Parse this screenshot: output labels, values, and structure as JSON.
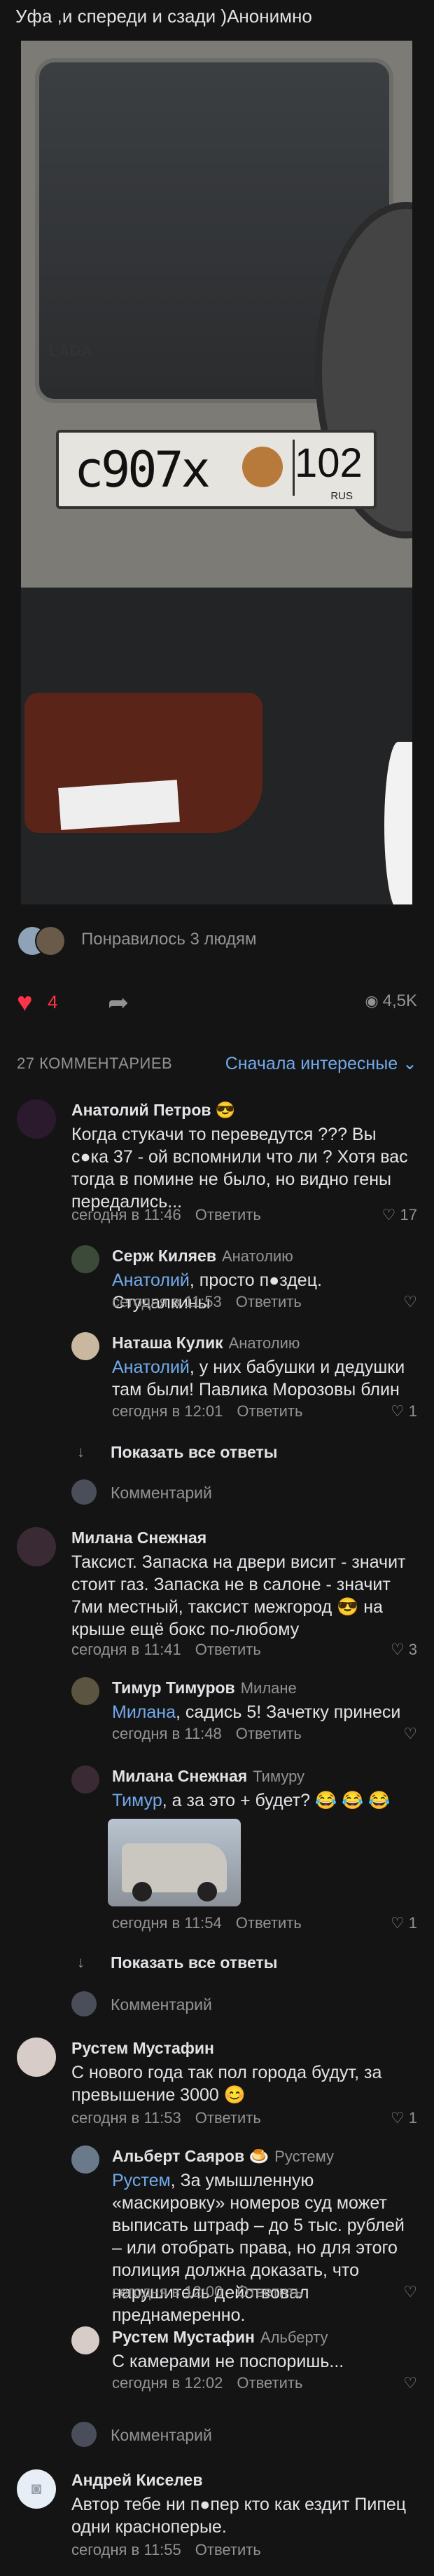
{
  "post": {
    "title": "Уфа ,и спереди и сзади )Анонимно",
    "plate_number": "с907х",
    "plate_region": "102",
    "plate_country": "RUS",
    "car_badge": "LADA",
    "likes_text": "Понравилось 3 людям",
    "like_count": "4",
    "views": "4,5K"
  },
  "comments_header": {
    "count_label": "27 КОММЕНТАРИЕВ",
    "sort_label": "Сначала интересные ⌄"
  },
  "comments": [
    {
      "name": "Анатолий Петров 😎",
      "text": "Когда стукачи то переведутся ??? Вы с●ка 37 - ой вспомнили что ли ? Хотя вас тогда в помине не было, но видно гены передались...",
      "time": "сегодня в 11:46",
      "answer": "Ответить",
      "likes": "17",
      "avatar_color": "#2b1a2e"
    },
    {
      "name": "Серж Киляев",
      "reply_to": "Анатолию",
      "mention": "Анатолий",
      "text": ", просто п●здец. Стучалкины",
      "time": "сегодня в 11:53",
      "answer": "Ответить",
      "likes": "",
      "avatar_color": "#3c4a3a"
    },
    {
      "name": "Наташа Кулик",
      "reply_to": "Анатолию",
      "mention": "Анатолий",
      "text": ", у них бабушки и дедушки там были! Павлика Морозовы блин",
      "time": "сегодня в 12:01",
      "answer": "Ответить",
      "likes": "1",
      "avatar_color": "#c9b7a0"
    },
    {
      "name": "Милана Снежная",
      "text": "Таксист. Запаска на двери висит - значит стоит газ. Запаска не в салоне - значит 7ми местный, таксист межгород 😎 на крыше ещё бокс по-любому",
      "time": "сегодня в 11:41",
      "answer": "Ответить",
      "likes": "3",
      "avatar_color": "#3a2a33"
    },
    {
      "name": "Тимур Тимуров",
      "reply_to": "Милане",
      "mention": "Милана",
      "text": ", садись 5! Зачетку принеси",
      "time": "сегодня в 11:48",
      "answer": "Ответить",
      "likes": "",
      "avatar_color": "#5a5440"
    },
    {
      "name": "Милана Снежная",
      "reply_to": "Тимуру",
      "mention": "Тимур",
      "text": ", а за это + будет? 😂 😂 😂",
      "time": "сегодня в 11:54",
      "answer": "Ответить",
      "likes": "1",
      "avatar_color": "#3a2a33"
    },
    {
      "name": "Рустем Мустафин",
      "text": "С нового года так пол города будут, за превышение 3000 😊",
      "time": "сегодня в 11:53",
      "answer": "Ответить",
      "likes": "1",
      "avatar_color": "#d7ccc8"
    },
    {
      "name": "Альберт Саяров 🍮",
      "reply_to": "Рустему",
      "mention": "Рустем",
      "text": ", За умышленную «маскировку» номеров суд может выписать штраф – до 5 тыс. рублей – или отобрать права, но для этого полиция должна доказать, что нарушитель действовал преднамеренно.",
      "time": "сегодня в 12:00",
      "answer": "Ответить",
      "likes": "",
      "avatar_color": "#6b7a8a"
    },
    {
      "name": "Рустем Мустафин",
      "reply_to": "Альберту",
      "text": "С камерами не поспоришь...",
      "time": "сегодня в 12:02",
      "answer": "Ответить",
      "likes": "",
      "avatar_color": "#d7ccc8"
    },
    {
      "name": "Андрей Киселев",
      "text": "Автор тебе ни п●пер кто как ездит Пипец одни красноперые.",
      "time": "сегодня в 11:55",
      "answer": "Ответить",
      "likes": "",
      "avatar_color": "#e8eef5"
    }
  ],
  "show_all_replies": "Показать все ответы",
  "comment_placeholder": "Комментарий",
  "icons": {
    "heart": "heart-icon",
    "share": "share-icon",
    "views": "eye-icon",
    "like": "heart-outline-icon",
    "reply_arrow": "arrow-down-icon",
    "camera": "camera-icon"
  },
  "colors": {
    "accent": "#71aaeb",
    "like_active": "#ff3347",
    "muted": "#939393",
    "background": "#141414"
  }
}
